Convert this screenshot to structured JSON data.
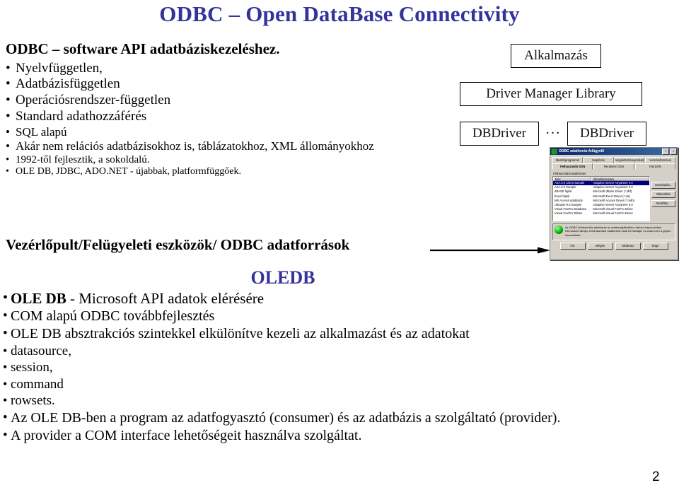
{
  "slide": {
    "title": "ODBC – Open DataBase Connectivity",
    "title_color": "#33339a",
    "page_number": "2"
  },
  "left_block": {
    "lead": "ODBC – software API adatbáziskezeléshez.",
    "bullets_level1": [
      "Nyelvfüggetlen,",
      "Adatbázisfüggetlen",
      "Operációsrendszer-független",
      "Standard adathozzáférés"
    ],
    "bullets_level2": [
      "SQL alapú",
      "Akár nem relációs adatbázisokhoz is, táblázatokhoz, XML állományokhoz"
    ],
    "bullets_level3": [
      "1992-től fejlesztik, a sokoldalú."
    ],
    "bullets_level4": [
      "OLE DB, JDBC, ADO.NET - újabbak, platformfüggőek."
    ],
    "control_panel_line": "Vezérlőpult/Felügyeleti eszközök/ ODBC adatforrások",
    "arrow_icon": "right-arrow-icon"
  },
  "oledb_block": {
    "heading": "OLEDB",
    "heading_color": "#33339a",
    "item_bold": "OLE DB",
    "item_rest": " - Microsoft API adatok elérésére",
    "sub_items": [
      "COM alapú ODBC továbbfejlesztés",
      "OLE DB absztrakciós szintekkel elkülönítve kezeli az alkalmazást és az adatokat"
    ],
    "abstraction_levels": [
      "datasource,",
      "session,",
      "command",
      "rowsets."
    ],
    "closing_items": [
      "Az OLE DB-ben a program az adatfogyasztó (consumer) és az adatbázis a szolgáltató (provider).",
      "A provider a COM interface lehetőségeit használva szolgáltat."
    ]
  },
  "architecture_diagram": {
    "application_box": "Alkalmazás",
    "driver_manager_box": "Driver Manager Library",
    "driver_box_left": "DBDriver",
    "driver_box_right": "DBDriver",
    "ellipsis": "···"
  },
  "odbc_dialog": {
    "title": "ODBC adatforrás-felügyelő",
    "title_icon": "odbc-icon",
    "help_button": "?",
    "close_button": "×",
    "tabs_row1": [
      "Illesztőprogramok",
      "Naplózás",
      "Megosztott kapcsolatok",
      "Verzióinformáció"
    ],
    "tabs_row2": [
      "Felhasználói DSN",
      "Rendszer DSN",
      "Fájl DSN"
    ],
    "active_tab": "Felhasználói DSN",
    "list_label": "Felhasználói adatforrás:",
    "columns": [
      "Név",
      "Illesztőprogram"
    ],
    "rows": [
      {
        "name": "ASA 9.0 Client Sample",
        "driver": "Adaptive Server Anywhere 9.0",
        "selected": true
      },
      {
        "name": "ASA 9.0 Sample",
        "driver": "Adaptive Server Anywhere 9.0",
        "selected": false
      },
      {
        "name": "dBASE fájlok",
        "driver": "Microsoft dBase Driver (*.dbf)",
        "selected": false
      },
      {
        "name": "Excel fájlok",
        "driver": "Microsoft Excel Driver (*.xls)",
        "selected": false
      },
      {
        "name": "MS Access adatbázis",
        "driver": "Microsoft Access Driver (*.mdb)",
        "selected": false
      },
      {
        "name": "UltraLite 9.0 Sample",
        "driver": "Adaptive Server Anywhere 9.0",
        "selected": false
      },
      {
        "name": "Visual FoxPro Database",
        "driver": "Microsoft Visual FoxPro Driver",
        "selected": false
      },
      {
        "name": "Visual FoxPro Tables",
        "driver": "Microsoft Visual FoxPro Driver",
        "selected": false
      }
    ],
    "side_buttons": [
      "Hozzáadás...",
      "Eltávolítás",
      "Beállítás..."
    ],
    "info_icon": "odbc-globe-icon",
    "info_text": "Az ODBC felhasználói adatforrás az adatszolgáltatóhoz tartozó kapcsolódási információt tárolja. A felhasználói adatforrást csak Ön láthatja, és csak ezen a gépen használható.",
    "bottom_buttons": [
      "OK",
      "Mégse",
      "Alkalmaz",
      "Súgó"
    ]
  }
}
